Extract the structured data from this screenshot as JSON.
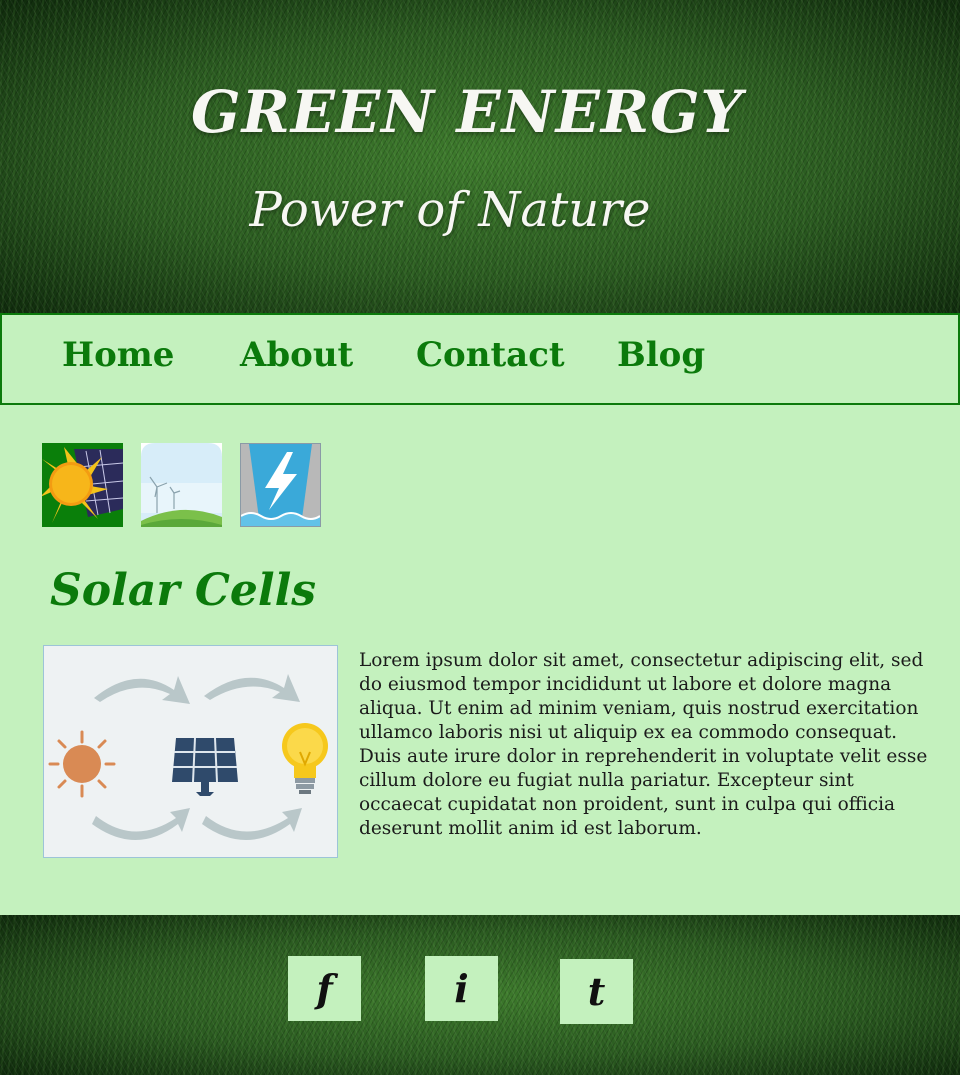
{
  "hero": {
    "title": "GREEN ENERGY",
    "subtitle": "Power of Nature"
  },
  "nav": {
    "items": [
      {
        "label": "Home"
      },
      {
        "label": "About"
      },
      {
        "label": "Contact"
      },
      {
        "label": "Blog"
      }
    ]
  },
  "thumbnails": [
    {
      "icon": "solar-panel-sun-icon"
    },
    {
      "icon": "wind-turbine-icon"
    },
    {
      "icon": "hydro-power-icon"
    }
  ],
  "article": {
    "title": "Solar Cells",
    "image_icon": "sun-to-panel-to-bulb-icon",
    "body": "Lorem ipsum dolor sit amet, consectetur adipiscing elit, sed do eiusmod tempor incididunt ut labore et dolore magna aliqua. Ut enim ad minim veniam, quis nostrud exercitation ullamco laboris nisi ut aliquip ex ea commodo consequat. Duis aute irure dolor in reprehenderit in voluptate velit esse cillum dolore eu fugiat nulla pariatur. Excepteur sint occaecat cupidatat non proident, sunt in culpa qui officia deserunt mollit anim id est laborum."
  },
  "footer": {
    "social": [
      {
        "label": "f",
        "icon": "facebook-icon"
      },
      {
        "label": "i",
        "icon": "instagram-icon"
      },
      {
        "label": "t",
        "icon": "twitter-icon"
      }
    ]
  },
  "colors": {
    "accent_green": "#0b7a0b",
    "panel_background": "#c4f1be",
    "hero_text": "#f7f7f3"
  }
}
